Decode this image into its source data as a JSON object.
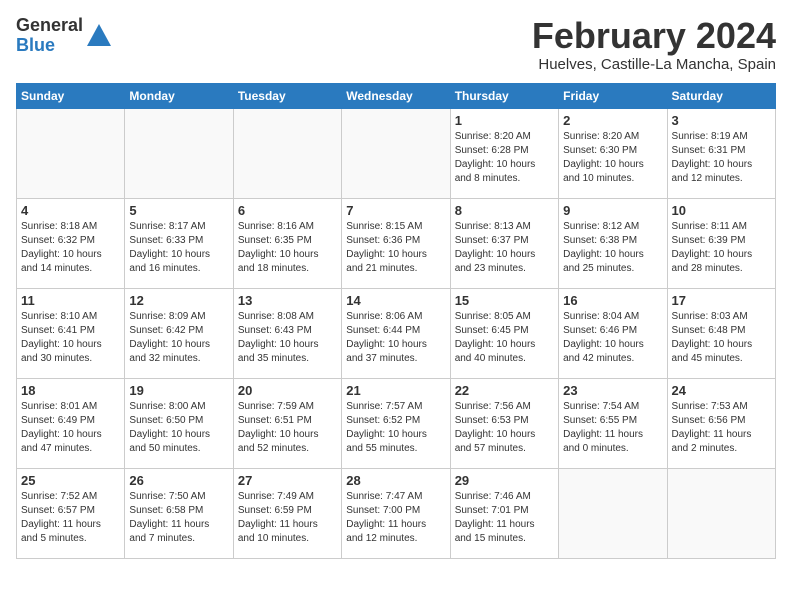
{
  "logo": {
    "general": "General",
    "blue": "Blue"
  },
  "title": "February 2024",
  "subtitle": "Huelves, Castille-La Mancha, Spain",
  "weekdays": [
    "Sunday",
    "Monday",
    "Tuesday",
    "Wednesday",
    "Thursday",
    "Friday",
    "Saturday"
  ],
  "weeks": [
    [
      {
        "day": "",
        "info": ""
      },
      {
        "day": "",
        "info": ""
      },
      {
        "day": "",
        "info": ""
      },
      {
        "day": "",
        "info": ""
      },
      {
        "day": "1",
        "info": "Sunrise: 8:20 AM\nSunset: 6:28 PM\nDaylight: 10 hours\nand 8 minutes."
      },
      {
        "day": "2",
        "info": "Sunrise: 8:20 AM\nSunset: 6:30 PM\nDaylight: 10 hours\nand 10 minutes."
      },
      {
        "day": "3",
        "info": "Sunrise: 8:19 AM\nSunset: 6:31 PM\nDaylight: 10 hours\nand 12 minutes."
      }
    ],
    [
      {
        "day": "4",
        "info": "Sunrise: 8:18 AM\nSunset: 6:32 PM\nDaylight: 10 hours\nand 14 minutes."
      },
      {
        "day": "5",
        "info": "Sunrise: 8:17 AM\nSunset: 6:33 PM\nDaylight: 10 hours\nand 16 minutes."
      },
      {
        "day": "6",
        "info": "Sunrise: 8:16 AM\nSunset: 6:35 PM\nDaylight: 10 hours\nand 18 minutes."
      },
      {
        "day": "7",
        "info": "Sunrise: 8:15 AM\nSunset: 6:36 PM\nDaylight: 10 hours\nand 21 minutes."
      },
      {
        "day": "8",
        "info": "Sunrise: 8:13 AM\nSunset: 6:37 PM\nDaylight: 10 hours\nand 23 minutes."
      },
      {
        "day": "9",
        "info": "Sunrise: 8:12 AM\nSunset: 6:38 PM\nDaylight: 10 hours\nand 25 minutes."
      },
      {
        "day": "10",
        "info": "Sunrise: 8:11 AM\nSunset: 6:39 PM\nDaylight: 10 hours\nand 28 minutes."
      }
    ],
    [
      {
        "day": "11",
        "info": "Sunrise: 8:10 AM\nSunset: 6:41 PM\nDaylight: 10 hours\nand 30 minutes."
      },
      {
        "day": "12",
        "info": "Sunrise: 8:09 AM\nSunset: 6:42 PM\nDaylight: 10 hours\nand 32 minutes."
      },
      {
        "day": "13",
        "info": "Sunrise: 8:08 AM\nSunset: 6:43 PM\nDaylight: 10 hours\nand 35 minutes."
      },
      {
        "day": "14",
        "info": "Sunrise: 8:06 AM\nSunset: 6:44 PM\nDaylight: 10 hours\nand 37 minutes."
      },
      {
        "day": "15",
        "info": "Sunrise: 8:05 AM\nSunset: 6:45 PM\nDaylight: 10 hours\nand 40 minutes."
      },
      {
        "day": "16",
        "info": "Sunrise: 8:04 AM\nSunset: 6:46 PM\nDaylight: 10 hours\nand 42 minutes."
      },
      {
        "day": "17",
        "info": "Sunrise: 8:03 AM\nSunset: 6:48 PM\nDaylight: 10 hours\nand 45 minutes."
      }
    ],
    [
      {
        "day": "18",
        "info": "Sunrise: 8:01 AM\nSunset: 6:49 PM\nDaylight: 10 hours\nand 47 minutes."
      },
      {
        "day": "19",
        "info": "Sunrise: 8:00 AM\nSunset: 6:50 PM\nDaylight: 10 hours\nand 50 minutes."
      },
      {
        "day": "20",
        "info": "Sunrise: 7:59 AM\nSunset: 6:51 PM\nDaylight: 10 hours\nand 52 minutes."
      },
      {
        "day": "21",
        "info": "Sunrise: 7:57 AM\nSunset: 6:52 PM\nDaylight: 10 hours\nand 55 minutes."
      },
      {
        "day": "22",
        "info": "Sunrise: 7:56 AM\nSunset: 6:53 PM\nDaylight: 10 hours\nand 57 minutes."
      },
      {
        "day": "23",
        "info": "Sunrise: 7:54 AM\nSunset: 6:55 PM\nDaylight: 11 hours\nand 0 minutes."
      },
      {
        "day": "24",
        "info": "Sunrise: 7:53 AM\nSunset: 6:56 PM\nDaylight: 11 hours\nand 2 minutes."
      }
    ],
    [
      {
        "day": "25",
        "info": "Sunrise: 7:52 AM\nSunset: 6:57 PM\nDaylight: 11 hours\nand 5 minutes."
      },
      {
        "day": "26",
        "info": "Sunrise: 7:50 AM\nSunset: 6:58 PM\nDaylight: 11 hours\nand 7 minutes."
      },
      {
        "day": "27",
        "info": "Sunrise: 7:49 AM\nSunset: 6:59 PM\nDaylight: 11 hours\nand 10 minutes."
      },
      {
        "day": "28",
        "info": "Sunrise: 7:47 AM\nSunset: 7:00 PM\nDaylight: 11 hours\nand 12 minutes."
      },
      {
        "day": "29",
        "info": "Sunrise: 7:46 AM\nSunset: 7:01 PM\nDaylight: 11 hours\nand 15 minutes."
      },
      {
        "day": "",
        "info": ""
      },
      {
        "day": "",
        "info": ""
      }
    ]
  ]
}
